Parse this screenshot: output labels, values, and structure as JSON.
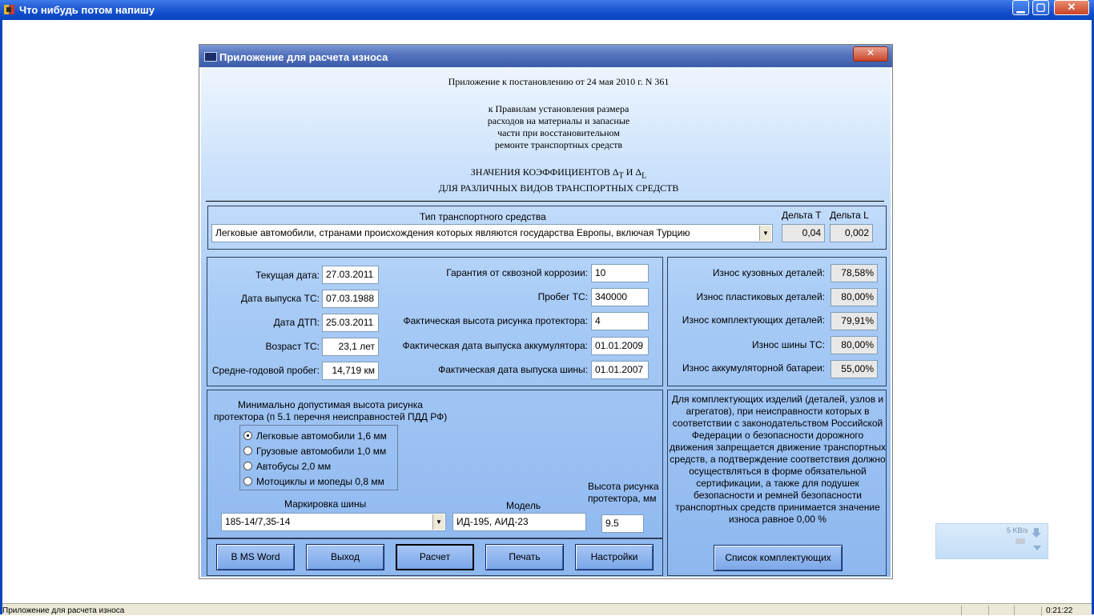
{
  "outer_window": {
    "title": "Что нибудь потом напишу",
    "min": "▁",
    "max": "▢",
    "close": "✕"
  },
  "status_bar": {
    "text": "Приложение для расчета износа",
    "clock": "0:21:22"
  },
  "net_widget": {
    "speed": "5 KB/s"
  },
  "dialog": {
    "title": "Приложение для расчета износа",
    "close_label": "✕",
    "header": {
      "line1": "Приложение к постановлению от 24 мая 2010 г. N 361",
      "rules": [
        "к Правилам установления размера",
        "расходов на материалы и запасные",
        "части при восстановительном",
        "ремонте транспортных средств"
      ],
      "coef_line1": "ЗНАЧЕНИЯ КОЭФФИЦИЕНТОВ Δ",
      "coef_sub_t": "Т",
      "coef_and": " И Δ",
      "coef_sub_l": "L",
      "coef_line2": "ДЛЯ РАЗЛИЧНЫХ ВИДОВ ТРАНСПОРТНЫХ СРЕДСТВ"
    },
    "vehicle": {
      "type_label": "Тип транспортного средства",
      "delta_t_label": "Дельта T",
      "delta_l_label": "Дельта L",
      "type_value": "Легковые автомобили, странами происхождения которых являются государства Европы, включая Турцию",
      "delta_t": "0,04",
      "delta_l": "0,002"
    },
    "dates": {
      "current_date_label": "Текущая дата:",
      "current_date": "27.03.2011",
      "release_label": "Дата выпуска ТС:",
      "release": "07.03.1988",
      "accident_label": "Дата ДТП:",
      "accident": "25.03.2011",
      "age_label": "Возраст ТС:",
      "age": "23,1 лет",
      "avg_mileage_label": "Средне-годовой пробег:",
      "avg_mileage": "14,719 км"
    },
    "params": {
      "corrosion_label": "Гарантия от сквозной коррозии:",
      "corrosion": "10",
      "mileage_label": "Пробег ТС:",
      "mileage": "340000",
      "tread_label": "Фактическая высота рисунка протектора:",
      "tread": "4",
      "battery_label": "Фактическая дата выпуска аккумулятора:",
      "battery": "01.01.2009",
      "tire_date_label": "Фактическая дата выпуска шины:",
      "tire_date": "01.01.2007"
    },
    "wear": {
      "body_label": "Износ кузовных деталей:",
      "body": "78,58%",
      "plastic_label": "Износ  пластиковых деталей:",
      "plastic": "80,00%",
      "components_label": "Износ комплектующих деталей:",
      "components": "79,91%",
      "tires_label": "Износ шины ТС:",
      "tires": "80,00%",
      "battery_label": "Износ аккумуляторной батареи:",
      "battery": "55,00%"
    },
    "tread_min": {
      "title1": "Минимально допустимая высота рисунка",
      "title2": "протектора (п 5.1 перечня неисправностей ПДД РФ)",
      "options": [
        "Легковые автомобили 1,6 мм",
        "Грузовые автомобили 1,0 мм",
        "Автобусы 2,0 мм",
        "Мотоциклы и мопеды 0,8 мм"
      ],
      "selected": "Легковые автомобили 1,6 мм"
    },
    "tire": {
      "marking_label": "Маркировка шины",
      "marking": "185-14/7,35-14",
      "model_label": "Модель",
      "model": "ИД-195, АИД-23",
      "height_label1": "Высота рисунка",
      "height_label2": "протектора, мм",
      "height": "9.5"
    },
    "note": "Для комплектующих изделий (деталей, узлов и агрегатов), при неисправности которых в соответствии с законодательством Российской Федерации о безопасности дорожного движения запрещается движение транспортных средств, а подтверждение соответствия должно осуществляться в форме обязательной сертификации, а также для подушек безопасности и ремней безопасности транспортных средств принимается значение износа равное 0,00 %",
    "buttons": {
      "word": "В MS Word",
      "exit": "Выход",
      "calc": "Расчет",
      "print": "Печать",
      "settings": "Настройки",
      "components_list": "Список комплектующих"
    }
  }
}
